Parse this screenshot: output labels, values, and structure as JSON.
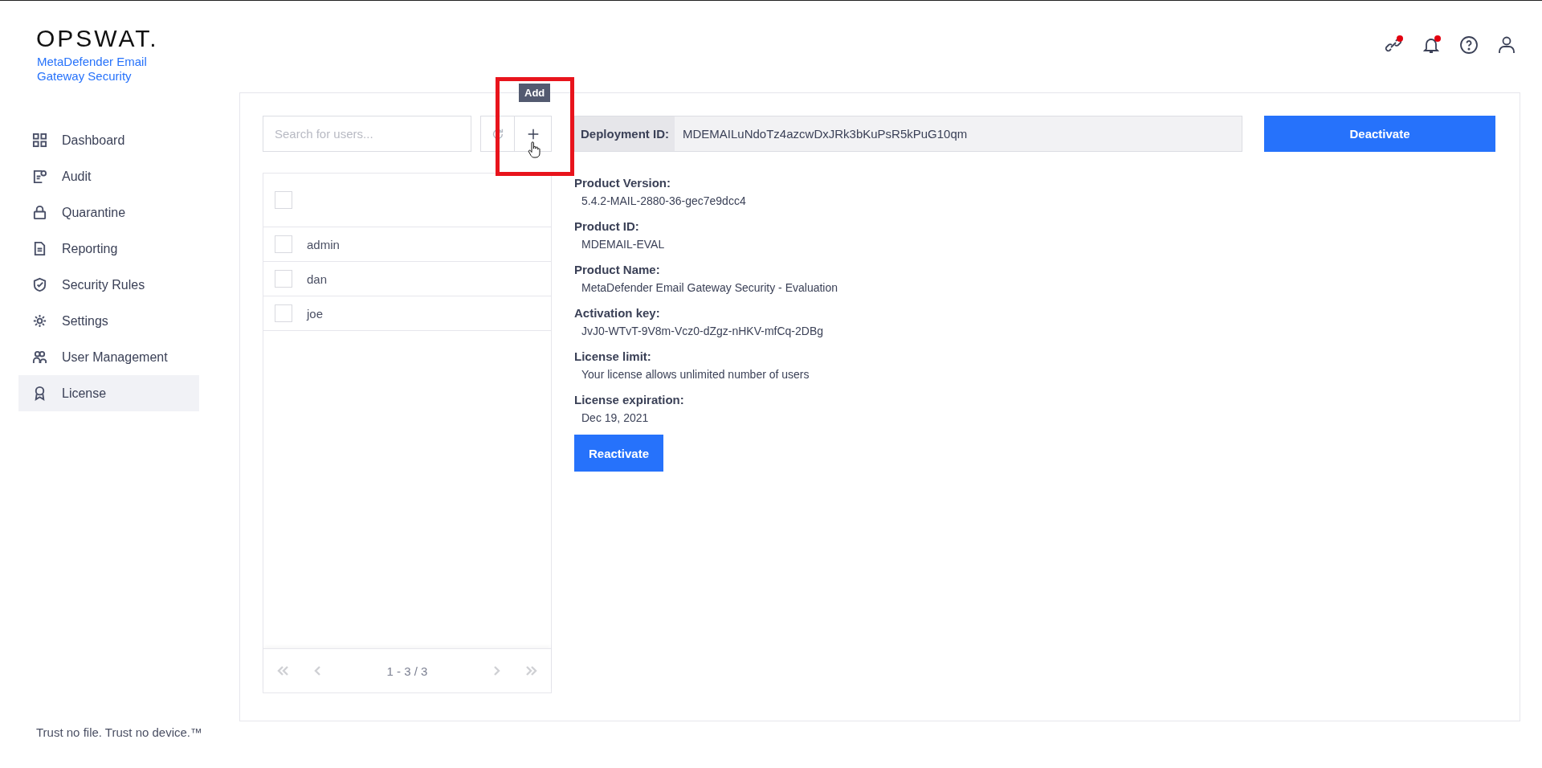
{
  "brand": {
    "logo": "OPSWAT.",
    "product": "MetaDefender Email Gateway Security"
  },
  "sidebar": {
    "items": [
      {
        "label": "Dashboard",
        "kind": "grid",
        "selected": false
      },
      {
        "label": "Audit",
        "kind": "audit",
        "selected": false
      },
      {
        "label": "Quarantine",
        "kind": "lock",
        "selected": false
      },
      {
        "label": "Reporting",
        "kind": "report",
        "selected": false
      },
      {
        "label": "Security Rules",
        "kind": "shield",
        "selected": false
      },
      {
        "label": "Settings",
        "kind": "gear",
        "selected": false
      },
      {
        "label": "User Management",
        "kind": "users",
        "selected": false
      },
      {
        "label": "License",
        "kind": "award",
        "selected": true
      }
    ]
  },
  "tagline": "Trust no file. Trust no device.™",
  "header_icons": [
    {
      "kind": "link",
      "dot": true
    },
    {
      "kind": "bell",
      "dot": true
    },
    {
      "kind": "help",
      "dot": false
    },
    {
      "kind": "user",
      "dot": false
    }
  ],
  "users": {
    "search": {
      "placeholder": "Search for users..."
    },
    "add_tooltip": "Add",
    "select_all": {
      "checked": false
    },
    "rows": [
      {
        "name": "admin",
        "checked": false
      },
      {
        "name": "dan",
        "checked": false
      },
      {
        "name": "joe",
        "checked": false
      }
    ],
    "pager": {
      "text": "1 - 3 / 3",
      "prev_disabled": true,
      "next_disabled": true
    }
  },
  "license": {
    "deployment_label": "Deployment ID:",
    "deployment_id": "MDEMAILuNdoTz4azcwDxJRk3bKuPsR5kPuG10qm",
    "deactivate": "Deactivate",
    "fields": [
      {
        "label": "Product Version:",
        "value": "5.4.2-MAIL-2880-36-gec7e9dcc4"
      },
      {
        "label": "Product ID:",
        "value": "MDEMAIL-EVAL"
      },
      {
        "label": "Product Name:",
        "value": "MetaDefender Email Gateway Security - Evaluation"
      },
      {
        "label": "Activation key:",
        "value": "JvJ0-WTvT-9V8m-Vcz0-dZgz-nHKV-mfCq-2DBg"
      },
      {
        "label": "License limit:",
        "value": "Your license allows unlimited number of users"
      },
      {
        "label": "License expiration:",
        "value": "Dec 19, 2021"
      }
    ],
    "reactivate": "Reactivate"
  }
}
